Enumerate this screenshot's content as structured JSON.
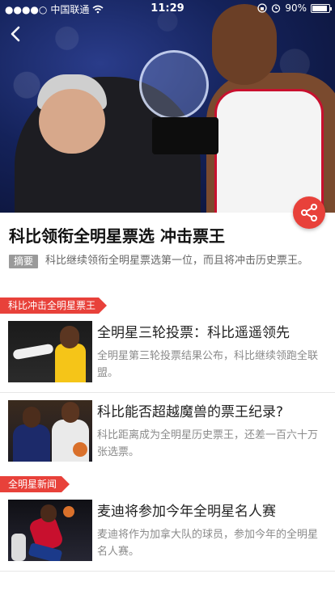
{
  "status_bar": {
    "carrier": "中国联通",
    "time": "11:29",
    "battery": "90%"
  },
  "article": {
    "title": "科比领衔全明星票选 冲击票王",
    "summary_label": "摘要",
    "summary": "科比继续领衔全明星票选第一位，而且将冲击历史票王。"
  },
  "sections": [
    {
      "title": "科比冲击全明星票王",
      "items": [
        {
          "headline": "全明星三轮投票：科比遥遥领先",
          "desc": "全明星第三轮投票结果公布，科比继续领跑全联盟。"
        },
        {
          "headline": "科比能否超越魔兽的票王纪录?",
          "desc": "科比距离成为全明星历史票王，还差一百六十万张选票。"
        }
      ]
    },
    {
      "title": "全明星新闻",
      "items": [
        {
          "headline": "麦迪将参加今年全明星名人赛",
          "desc": "麦迪将作为加拿大队的球员，参加今年的全明星名人赛。"
        }
      ]
    }
  ],
  "colors": {
    "accent": "#e8413a",
    "summary_tag": "#9a9a9a"
  }
}
